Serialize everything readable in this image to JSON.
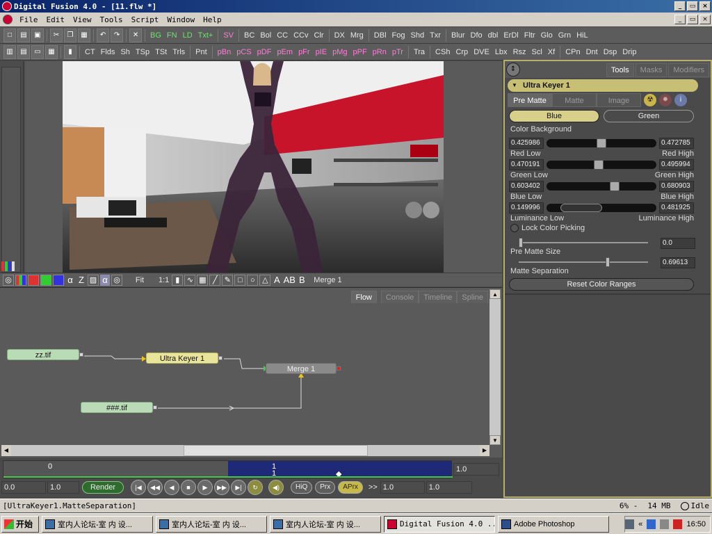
{
  "window": {
    "title": "Digital Fusion 4.0 - [11.flw *]",
    "controls": [
      "_",
      "▭",
      "×"
    ]
  },
  "menu": {
    "items": [
      "File",
      "Edit",
      "View",
      "Tools",
      "Script",
      "Window",
      "Help"
    ],
    "controls": [
      "_",
      "▭",
      "×"
    ]
  },
  "toolbar1": {
    "tools": [
      "BG",
      "FN",
      "LD",
      "Txt+",
      "SV",
      "BC",
      "Bol",
      "CC",
      "CCv",
      "Clr",
      "DX",
      "Mrg",
      "DBl",
      "Fog",
      "Shd",
      "Txr",
      "Blur",
      "Dfo",
      "dbl",
      "ErDl",
      "Fltr",
      "Glo",
      "Grn",
      "HiL"
    ]
  },
  "toolbar2": {
    "tools": [
      "CT",
      "Flds",
      "Sh",
      "TSp",
      "TSt",
      "Trls",
      "Pnt",
      "pBn",
      "pCS",
      "pDF",
      "pEm",
      "pFr",
      "pIE",
      "pMg",
      "pPF",
      "pRn",
      "pTr",
      "Tra",
      "CSh",
      "Crp",
      "DVE",
      "Lbx",
      "Rsz",
      "Scl",
      "Xf",
      "CPn",
      "Dnt",
      "Dsp",
      "Drip"
    ]
  },
  "viewer": {
    "channels": [
      "α",
      "Z",
      "α"
    ],
    "fit_label": "Fit",
    "scale_label": "1:1",
    "buttons": [
      "A",
      "AB",
      "B"
    ],
    "node_name": "Merge 1"
  },
  "flow": {
    "tabs": [
      "Flow",
      "Console",
      "Timeline",
      "Spline"
    ],
    "active_tab": "Flow",
    "nodes": {
      "loader1": "zz.tif",
      "keyer": "Ultra Keyer 1",
      "merge": "Merge 1",
      "loader2": "###.tif"
    }
  },
  "time": {
    "ruler_start": "0",
    "ruler_current": "1",
    "ruler_current_sub": "1",
    "ruler_end": "1.0",
    "start_field": "0.0",
    "end_field": "1.0",
    "render_label": "Render",
    "hiq_label": "HiQ",
    "prx_label": "Prx",
    "aprx_label": "APrx",
    "chevron": ">>",
    "current_field": "1.0",
    "right_field": "1.0"
  },
  "tools": {
    "tabs": [
      "Tools",
      "Masks",
      "Modifiers"
    ],
    "active_tab": "Tools",
    "keyer_title": "Ultra Keyer 1",
    "sub_tabs": [
      "Pre Matte",
      "Matte",
      "Image"
    ],
    "active_sub_tab": "Pre Matte",
    "color_buttons": {
      "blue": "Blue",
      "green": "Green"
    },
    "color_background_label": "Color Background",
    "ranges": [
      {
        "low_value": "0.425986",
        "high_value": "0.472785",
        "low_label": "Red Low",
        "high_label": "Red High",
        "thumb_pos": 0.5
      },
      {
        "low_value": "0.470191",
        "high_value": "0.495994",
        "low_label": "Green Low",
        "high_label": "Green High",
        "thumb_pos": 0.47
      },
      {
        "low_value": "0.603402",
        "high_value": "0.680903",
        "low_label": "Blue Low",
        "high_label": "Blue High",
        "thumb_pos": 0.63
      },
      {
        "low_value": "0.149996",
        "high_value": "0.481925",
        "low_label": "Luminance Low",
        "high_label": "Luminance High",
        "thumb_pos": 0.3
      }
    ],
    "lock_color_picking": "Lock Color Picking",
    "pre_matte_size": {
      "label": "Pre Matte Size",
      "value": "0.0",
      "fraction": 0.0
    },
    "matte_separation": {
      "label": "Matte Separation",
      "value": "0.69613",
      "fraction": 0.69613
    },
    "reset_label": "Reset Color Ranges"
  },
  "status": {
    "text": "[UltraKeyer1.MatteSeparation]",
    "zoom": "6% -",
    "memory": "14 MB",
    "state": "Idle"
  },
  "taskbar": {
    "start_label": "开始",
    "tasks": [
      "室内人论坛-室 内 设...",
      "室内人论坛-室 内 设...",
      "室内人论坛-室 内 设...",
      "Digital Fusion 4.0 ...",
      "Adobe Photoshop"
    ],
    "active_task": 3,
    "clock": "16:50"
  },
  "colors": {
    "accent_yellow": "#c7bf73",
    "node_loader": "#b9dbb6",
    "node_keyer": "#e8e49a",
    "timeline_range": "#1e2a78",
    "render_green": "#2f6a2f"
  }
}
